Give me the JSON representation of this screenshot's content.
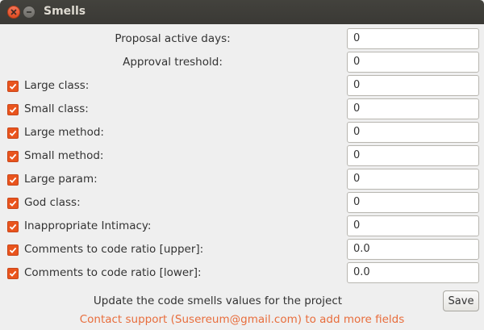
{
  "window": {
    "title": "Smells",
    "accent": "#e9541d"
  },
  "fields": [
    {
      "label": "Proposal active days:",
      "value": "0",
      "checkbox": false
    },
    {
      "label": "Approval treshold:",
      "value": "0",
      "checkbox": false
    },
    {
      "label": "Large class:",
      "value": "0",
      "checkbox": true,
      "checked": true
    },
    {
      "label": "Small class:",
      "value": "0",
      "checkbox": true,
      "checked": true
    },
    {
      "label": "Large method:",
      "value": "0",
      "checkbox": true,
      "checked": true
    },
    {
      "label": "Small method:",
      "value": "0",
      "checkbox": true,
      "checked": true
    },
    {
      "label": "Large param:",
      "value": "0",
      "checkbox": true,
      "checked": true
    },
    {
      "label": "God class:",
      "value": "0",
      "checkbox": true,
      "checked": true
    },
    {
      "label": "Inappropriate Intimacy:",
      "value": "0",
      "checkbox": true,
      "checked": true
    },
    {
      "label": "Comments to code ratio [upper]:",
      "value": "0.0",
      "checkbox": true,
      "checked": true
    },
    {
      "label": "Comments to code ratio [lower]:",
      "value": "0.0",
      "checkbox": true,
      "checked": true
    }
  ],
  "footer": {
    "description": "Update the code smells values for the project",
    "save_label": "Save",
    "contact": "Contact support (Susereum@gmail.com) to add more fields"
  }
}
